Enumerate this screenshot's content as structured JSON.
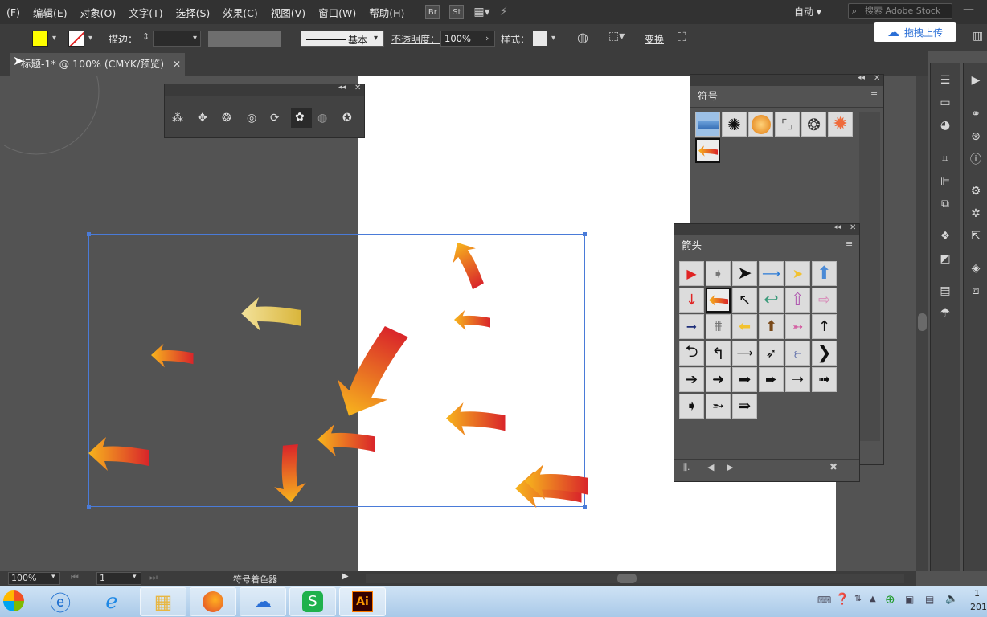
{
  "menu": [
    "(F)",
    "编辑(E)",
    "对象(O)",
    "文字(T)",
    "选择(S)",
    "效果(C)",
    "视图(V)",
    "窗口(W)",
    "帮助(H)"
  ],
  "menu_icons": {
    "bridge": "Br",
    "stock": "St"
  },
  "workspace": "自动",
  "search_placeholder": "搜索 Adobe Stock",
  "control": {
    "fill_color": "#ffff00",
    "stroke_label": "描边：",
    "line_style": "基本",
    "opacity_label": "不透明度：",
    "opacity_value": "100%",
    "style_label": "样式：",
    "transform_label": "变换"
  },
  "upload_label": "拖拽上传",
  "document_tab": "标题-1* @ 100% (CMYK/预览)",
  "panels": {
    "symbols_title": "符号",
    "arrows_title": "箭头"
  },
  "status": {
    "zoom": "100%",
    "page": "1",
    "tool": "符号着色器"
  },
  "taskbar": {
    "ai_label": "Ai",
    "clock_top": "1",
    "clock_bottom": "201"
  },
  "colors": {
    "accent": "#2a6fd6",
    "arrow_orange": "#f29a1c",
    "arrow_red": "#d92b2b"
  }
}
